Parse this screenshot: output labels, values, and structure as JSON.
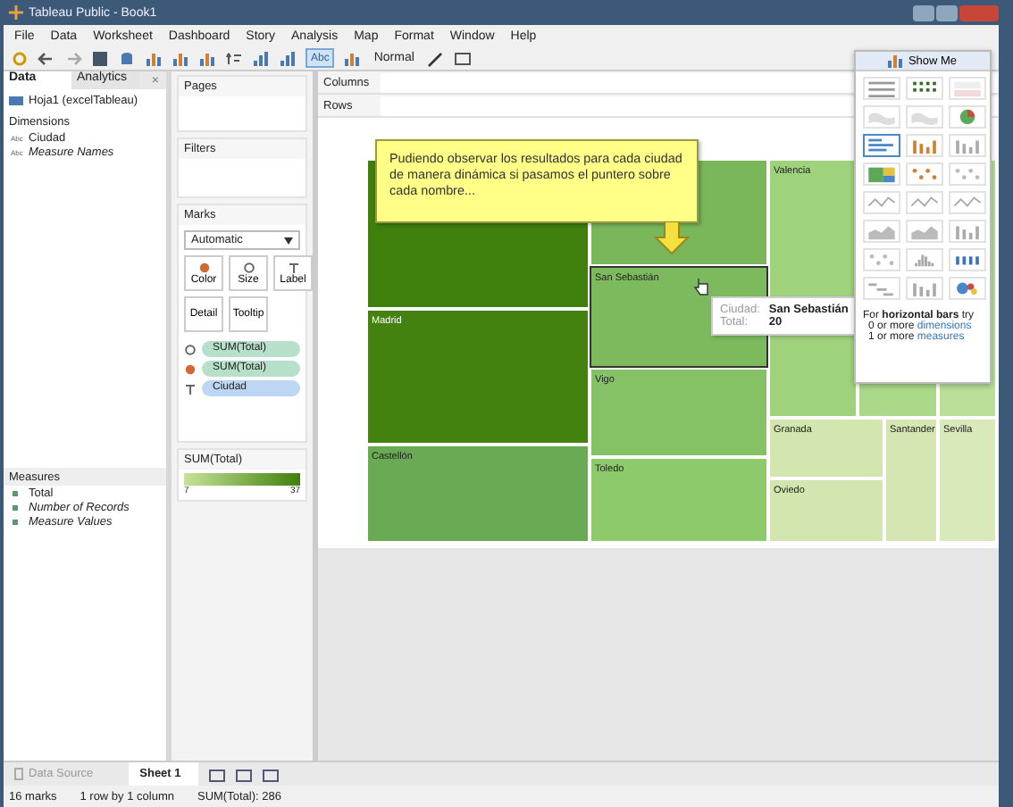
{
  "window": {
    "title": "Tableau Public - Book1"
  },
  "menu": [
    "File",
    "Data",
    "Worksheet",
    "Dashboard",
    "Story",
    "Analysis",
    "Map",
    "Format",
    "Window",
    "Help"
  ],
  "toolbar": {
    "label_button": {
      "text": "Abc",
      "selected": true
    },
    "fit": "Normal"
  },
  "data_pane": {
    "tabs": [
      {
        "label": "Data",
        "selected": true
      },
      {
        "label": "Analytics",
        "selected": false
      }
    ],
    "close": "×",
    "data_source": "Hoja1 (excelTableau)",
    "dimensions": {
      "title": "Dimensions",
      "items": [
        {
          "name": "Ciudad",
          "kind": "field",
          "type_tag": "Abc"
        },
        {
          "name": "Measure Names",
          "kind": "generated",
          "type_tag": "Abc"
        }
      ]
    },
    "measures": {
      "title": "Measures",
      "items": [
        {
          "name": "Total",
          "kind": "field"
        },
        {
          "name": "Number of Records",
          "kind": "generated"
        },
        {
          "name": "Measure Values",
          "kind": "generated"
        }
      ]
    }
  },
  "pages": {
    "title": "Pages"
  },
  "filters": {
    "title": "Filters"
  },
  "marks": {
    "title": "Marks",
    "type": "Automatic",
    "buttons": [
      {
        "label": "Color",
        "kind": "color"
      },
      {
        "label": "Size",
        "kind": "size"
      },
      {
        "label": "Label",
        "kind": "label"
      },
      {
        "label": "Detail",
        "kind": "detail"
      },
      {
        "label": "Tooltip",
        "kind": "tooltip"
      }
    ],
    "pills": [
      {
        "label": "SUM(Total)",
        "kind": "size",
        "measure": true
      },
      {
        "label": "SUM(Total)",
        "kind": "color",
        "measure": true
      },
      {
        "label": "Ciudad",
        "kind": "label",
        "measure": false
      }
    ]
  },
  "legend": {
    "title": "SUM(Total)",
    "min": "7",
    "max": "37"
  },
  "shelves": {
    "columns": "Columns",
    "rows": "Rows"
  },
  "treemap": {
    "tiles": [
      {
        "color": "#3f800c",
        "selected": false
      },
      {
        "label": "Madrid",
        "color": "#43820f",
        "selected": false
      },
      {
        "label": "Castellón",
        "color": "#6aaa55",
        "selected": false
      },
      {
        "color": "#79b75a",
        "selected": false
      },
      {
        "label": "San Sebastián",
        "color": "#7cba5d",
        "selected": true
      },
      {
        "label": "Vigo",
        "color": "#84c265",
        "selected": false
      },
      {
        "label": "Toledo",
        "color": "#8dca6c",
        "selected": false
      },
      {
        "label": "Valencia",
        "color": "#9fd37b",
        "selected": false
      },
      {
        "color": "#abd98a",
        "selected": false
      },
      {
        "color": "#b9df98",
        "selected": false
      },
      {
        "label": "Granada",
        "color": "#d4e6b0",
        "selected": false
      },
      {
        "label": "Oviedo",
        "color": "#d4e6b0",
        "selected": false
      },
      {
        "label": "Santander",
        "color": "#d6e6b3",
        "selected": false
      },
      {
        "label": "Sevilla",
        "color": "#d9e9b9",
        "selected": false
      }
    ]
  },
  "callout": {
    "text": "Pudiendo observar los resultados para cada ciudad de manera dinámica si pasamos el puntero sobre cada nombre..."
  },
  "tooltip": {
    "rows": [
      {
        "key": "Ciudad:",
        "value": "San Sebastián"
      },
      {
        "key": "Total:",
        "value": "20"
      }
    ]
  },
  "show_me": {
    "title": "Show Me",
    "options": [
      {
        "kind": "text-table",
        "selected": false
      },
      {
        "kind": "heat-map",
        "selected": false
      },
      {
        "kind": "highlight-table",
        "selected": false
      },
      {
        "kind": "symbol-map",
        "selected": false
      },
      {
        "kind": "filled-map",
        "selected": false
      },
      {
        "kind": "pie",
        "selected": false
      },
      {
        "kind": "horizontal-bars",
        "selected": true
      },
      {
        "kind": "stacked-bars",
        "selected": false
      },
      {
        "kind": "side-by-side-bars",
        "selected": false
      },
      {
        "kind": "treemap",
        "selected": false
      },
      {
        "kind": "circle-views",
        "selected": false
      },
      {
        "kind": "side-by-side-circles",
        "selected": false
      },
      {
        "kind": "lines-continuous",
        "selected": false
      },
      {
        "kind": "lines-discrete",
        "selected": false
      },
      {
        "kind": "dual-lines",
        "selected": false
      },
      {
        "kind": "area-continuous",
        "selected": false
      },
      {
        "kind": "area-discrete",
        "selected": false
      },
      {
        "kind": "dual-combination",
        "selected": false
      },
      {
        "kind": "scatter",
        "selected": false
      },
      {
        "kind": "histogram",
        "selected": false
      },
      {
        "kind": "box-whisker",
        "selected": false
      },
      {
        "kind": "gantt",
        "selected": false
      },
      {
        "kind": "bullet",
        "selected": false
      },
      {
        "kind": "packed-bubbles",
        "selected": false
      }
    ],
    "hint": {
      "title": "For **horizontal bars** try",
      "lines": [
        {
          "prefix": "0 or more",
          "keyword": "dimensions"
        },
        {
          "prefix": "1 or more",
          "keyword": "measures"
        }
      ]
    }
  },
  "sheet_tabs": [
    {
      "label": "Data Source",
      "kind": "data-source",
      "selected": false
    },
    {
      "label": "Sheet 1",
      "kind": "sheet",
      "selected": true
    }
  ],
  "status": [
    "16 marks",
    "1 row by 1 column",
    "SUM(Total): 286"
  ]
}
